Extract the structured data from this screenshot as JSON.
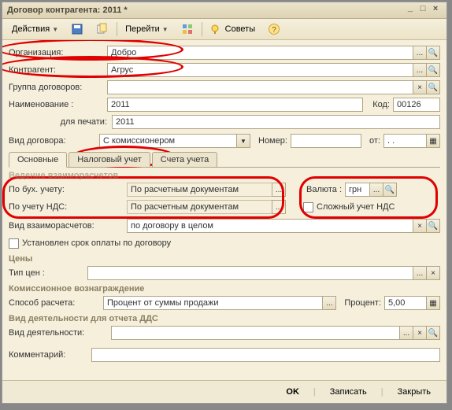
{
  "window": {
    "title": "Договор контрагента: 2011 *"
  },
  "toolbar": {
    "actions": "Действия",
    "goto": "Перейти",
    "advice": "Советы"
  },
  "labels": {
    "org": "Организация:",
    "counterparty": "Контрагент:",
    "group": "Группа договоров:",
    "name": "Наименование :",
    "code": "Код:",
    "forprint": "для печати:",
    "contract_type": "Вид договора:",
    "number": "Номер:",
    "from": "от:",
    "bybuh": "По бух. учету:",
    "byvat": "По учету НДС:",
    "currency": "Валюта :",
    "complex_vat": "Сложный  учет НДС",
    "settlement_type": "Вид взаиморасчетов:",
    "payment_term": "Установлен срок оплаты по договору",
    "price_type": "Тип цен :",
    "calc_method": "Способ расчета:",
    "percent": "Процент:",
    "activity_type": "Вид деятельности:",
    "comment": "Комментарий:"
  },
  "sections": {
    "settlements": "Ведение взаиморасчетов",
    "prices": "Цены",
    "commission": "Комиссионное вознаграждение",
    "dds": "Вид деятельности для отчета ДДС"
  },
  "values": {
    "org": "Добро",
    "counterparty": "Агрус",
    "group": "",
    "name": "2011",
    "code": "00126",
    "forprint": "2011",
    "contract_type": "С комиссионером",
    "number": "",
    "from": ".  .",
    "bybuh": "По расчетным документам",
    "byvat": "По расчетным документам",
    "currency": "грн",
    "settlement": "по договору в целом",
    "price_type": "",
    "calc_method": "Процент от суммы продажи",
    "percent": "5,00",
    "activity": "",
    "comment": ""
  },
  "tabs": {
    "main": "Основные",
    "tax": "Налоговый учет",
    "accounts": "Счета учета"
  },
  "footer": {
    "ok": "OK",
    "save": "Записать",
    "close": "Закрыть"
  },
  "glyphs": {
    "dots": "...",
    "mag": "🔍",
    "cal": "▦",
    "x": "×",
    "drop": "▼"
  }
}
